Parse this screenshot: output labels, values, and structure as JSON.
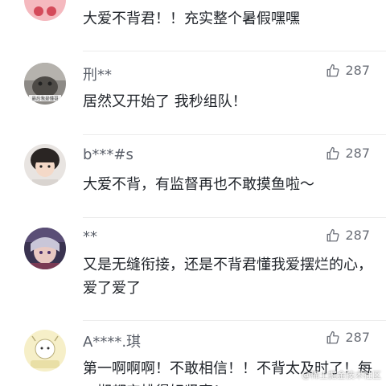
{
  "comments": [
    {
      "username": "",
      "text": "大爱不背君！！充实整个暑假嘿嘿",
      "likes": "",
      "avatar_icon": "pink-avatar-icon"
    },
    {
      "username": "刑**",
      "text": "居然又开始了 我秒组队！",
      "likes": "287",
      "avatar_icon": "cat-photo-avatar-icon",
      "avatar_caption": "最后我是懂哥"
    },
    {
      "username": "b***#s",
      "text": "大爱不背，有监督再也不敢摸鱼啦～",
      "likes": "287",
      "avatar_icon": "girl-photo-avatar-icon"
    },
    {
      "username": "**",
      "text": "又是无缝衔接，还是不背君懂我爱摆烂的心，爱了爱了",
      "likes": "287",
      "avatar_icon": "anime-avatar-icon"
    },
    {
      "username": "A****.琪",
      "text": "第一啊啊啊！不敢相信！！不背太及时了！每一期都安排得好紧密！",
      "likes": "287",
      "avatar_icon": "cartoon-avatar-icon"
    }
  ],
  "watermark": "@稀土掘金技术社区",
  "colors": {
    "username": "#5a5f69",
    "text": "#1f2329",
    "likes": "#6b6f78"
  },
  "icons": {
    "like": "thumbs-up-icon"
  }
}
